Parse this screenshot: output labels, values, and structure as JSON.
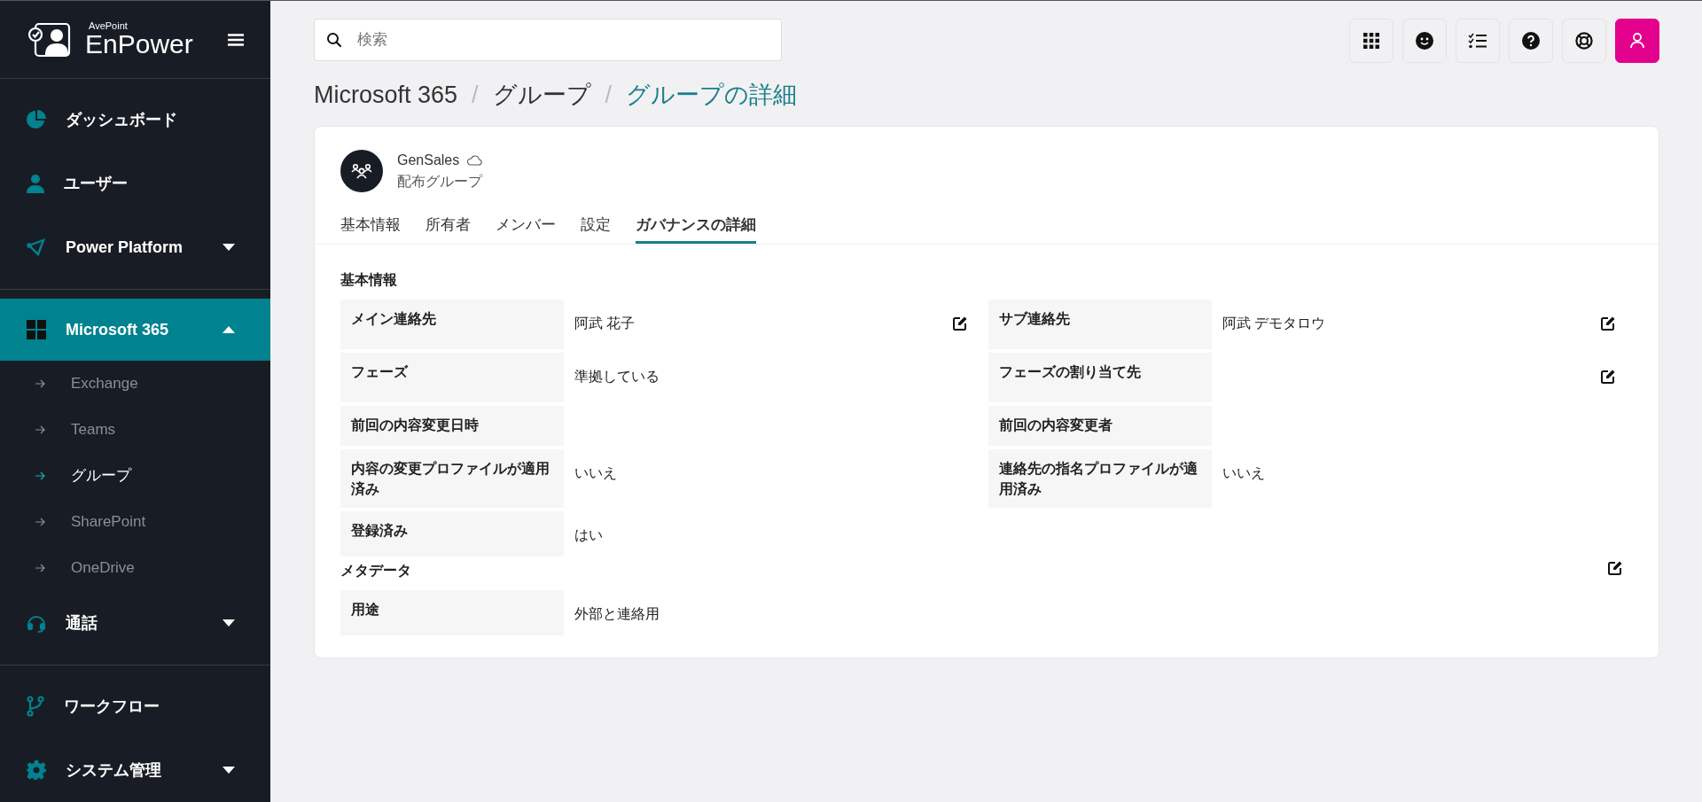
{
  "sidebar": {
    "brand": {
      "company": "AvePoint",
      "product": "EnPower"
    },
    "groups": [
      [
        {
          "label": "ダッシュボード",
          "selected": false
        },
        {
          "label": "ユーザー",
          "selected": false
        },
        {
          "label": "Power Platform",
          "selected": false,
          "expanded": false
        }
      ],
      [
        {
          "label": "Microsoft 365",
          "selected": true,
          "expanded": true,
          "children": [
            {
              "label": "Exchange",
              "selected": false
            },
            {
              "label": "Teams",
              "selected": false
            },
            {
              "label": "グループ",
              "selected": true
            },
            {
              "label": "SharePoint",
              "selected": false
            },
            {
              "label": "OneDrive",
              "selected": false
            }
          ]
        },
        {
          "label": "通話",
          "selected": false,
          "expanded": false
        }
      ],
      [
        {
          "label": "ワークフロー",
          "selected": false
        },
        {
          "label": "システム管理",
          "selected": false,
          "expanded": false
        }
      ]
    ]
  },
  "search": {
    "placeholder": "検索"
  },
  "breadcrumb": [
    {
      "label": "Microsoft 365",
      "current": false
    },
    {
      "separator": "/",
      "label": "グループ",
      "current": false
    },
    {
      "separator": "/",
      "label": "グループの詳細",
      "current": true
    }
  ],
  "group": {
    "name": "GenSales",
    "type": "配布グループ"
  },
  "tabs": [
    {
      "label": "基本情報",
      "selected": false
    },
    {
      "label": "所有者",
      "selected": false
    },
    {
      "label": "メンバー",
      "selected": false
    },
    {
      "label": "設定",
      "selected": false
    },
    {
      "label": "ガバナンスの詳細",
      "selected": true
    }
  ],
  "sections": [
    {
      "title": "基本情報",
      "editable": false,
      "fields": [
        {
          "label": "メイン連絡先",
          "value": "阿武 花子",
          "editable": true
        },
        {
          "label": "サブ連絡先",
          "value": "阿武 デモタロウ",
          "editable": true
        },
        {
          "label": "フェーズ",
          "value": "準拠している",
          "editable": false
        },
        {
          "label": "フェーズの割り当て先",
          "editable": true
        },
        {
          "label": "前回の内容変更日時",
          "editable": false
        },
        {
          "label": "前回の内容変更者",
          "editable": false
        },
        {
          "label": "内容の変更プロファイルが適用済み",
          "value": "いいえ",
          "editable": false
        },
        {
          "label": "連絡先の指名プロファイルが適用済み",
          "value": "いいえ",
          "editable": false
        },
        {
          "label": "登録済み",
          "value": "はい",
          "editable": false
        }
      ]
    },
    {
      "title": "メタデータ",
      "editable": true,
      "fields": [
        {
          "label": "用途",
          "value": "外部と連絡用",
          "editable": false
        }
      ]
    }
  ]
}
